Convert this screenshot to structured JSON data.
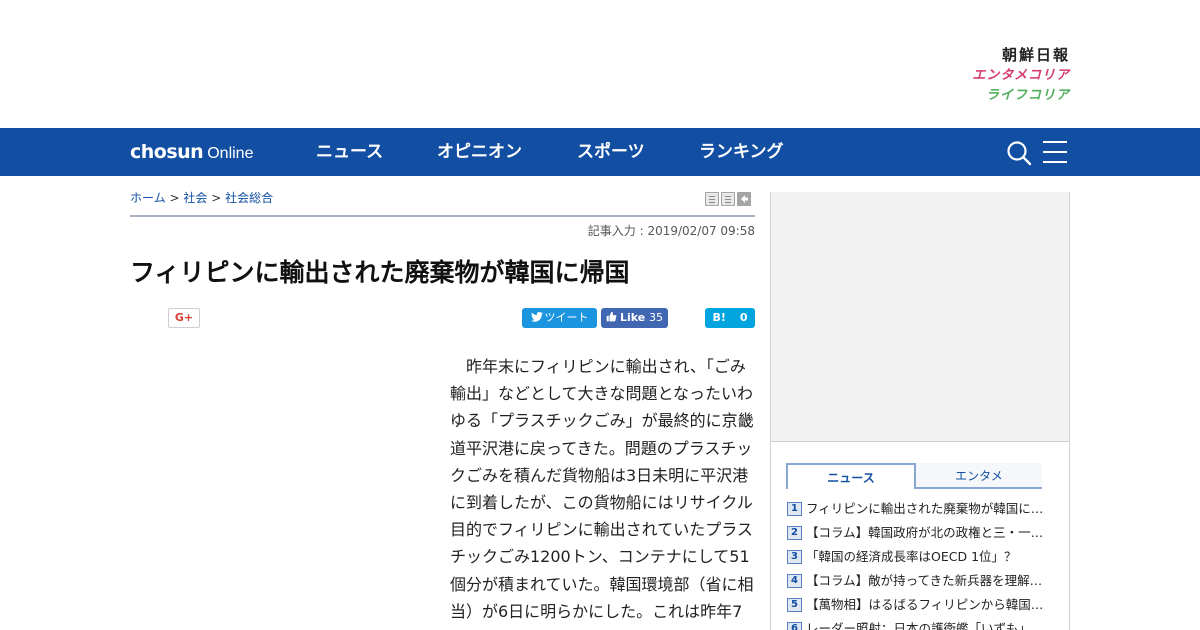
{
  "brand": {
    "chosun_nippo": "朝鮮日報",
    "entame_korea": "エンタメコリア",
    "life_korea": "ライフコリア"
  },
  "nav": {
    "logo_bold": "chosun",
    "logo_light": "Online",
    "items": [
      "ニュース",
      "オピニオン",
      "スポーツ",
      "ランキング"
    ],
    "icons": [
      "search-icon",
      "hamburger-menu-icon"
    ]
  },
  "breadcrumb": {
    "home": "ホーム",
    "separator": ">",
    "section": "社会",
    "subsection": "社会総合"
  },
  "article": {
    "dateline": "記事入力 : 2019/02/07 09:58",
    "headline": "フィリピンに輸出された廃棄物が韓国に帰国",
    "body": "昨年末にフィリピンに輸出され、「ごみ輸出」などとして大きな問題となったいわゆる「プラスチックごみ」が最終的に京畿道平沢港に戻ってきた。問題のプラスチックごみを積んだ貨物船は3日未明に平沢港に到着したが、この貨物船にはリサイクル目的でフィリピンに輸出されていたプラスチックごみ1200トン、コンテナにして51個分が積まれていた。韓国環境部（省に相当）が6日に明らかにした。これは昨年7"
  },
  "share": {
    "gplus": "G+",
    "tweet": "ツイート",
    "fb_like": "Like",
    "fb_count": "35",
    "hatena": "B!",
    "hatena_count": "0"
  },
  "sidebar": {
    "tabs": [
      "ニュース",
      "エンタメ"
    ],
    "ranking": [
      {
        "rank": "1",
        "title": "フィリピンに輸出された廃棄物が韓国に帰国"
      },
      {
        "rank": "2",
        "title": "【コラム】韓国政府が北の政権と三・一節を共同記念"
      },
      {
        "rank": "3",
        "title": "「韓国の経済成長率はOECD 1位」？"
      },
      {
        "rank": "4",
        "title": "【コラム】敵が持ってきた新兵器を理解できない韓国"
      },
      {
        "rank": "5",
        "title": "【萬物相】はるばるフィリピンから韓国に戻ってきたごみ"
      },
      {
        "rank": "6",
        "title": "レーダー照射：日本の護衛艦「いずも」"
      }
    ]
  },
  "colors": {
    "nav_blue": "#124fa3",
    "entame_pink": "#d63b6b",
    "life_green": "#4cae5a",
    "tweet_blue": "#1b95e0",
    "facebook_blue": "#4267b2",
    "hatena_blue": "#00a4de"
  }
}
